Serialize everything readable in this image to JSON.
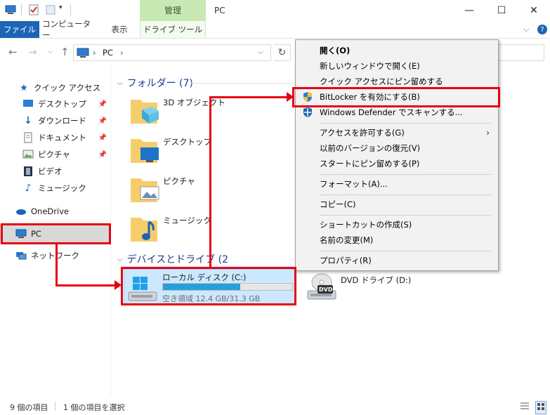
{
  "window": {
    "title": "PC",
    "contextual_tab_header": "管理"
  },
  "ribbon": {
    "tabs": [
      "ファイル",
      "コンピューター",
      "表示",
      "ドライブ ツール"
    ]
  },
  "address": {
    "path": [
      "PC"
    ],
    "separator": "›"
  },
  "nav": {
    "quick_access": "クイック アクセス",
    "items": [
      {
        "label": "デスクトップ",
        "pinned": true
      },
      {
        "label": "ダウンロード",
        "pinned": true
      },
      {
        "label": "ドキュメント",
        "pinned": true
      },
      {
        "label": "ピクチャ",
        "pinned": true
      },
      {
        "label": "ビデオ",
        "pinned": false
      },
      {
        "label": "ミュージック",
        "pinned": false
      }
    ],
    "onedrive": "OneDrive",
    "pc": "PC",
    "network": "ネットワーク"
  },
  "content": {
    "folders_header": "フォルダー (7)",
    "folders": [
      "3D オブジェクト",
      "デスクトップ",
      "ピクチャ",
      "ミュージック"
    ],
    "devices_header": "デバイスとドライブ (2",
    "drive_c": {
      "label": "ローカル ディスク (C:)",
      "space": "空き領域 12.4 GB/31.3 GB",
      "used_fraction": 0.6
    },
    "drive_d": {
      "label": "DVD ドライブ (D:)",
      "icon_text": "DVD"
    }
  },
  "context_menu": {
    "items": [
      "開く(O)",
      "新しいウィンドウで開く(E)",
      "クイック アクセスにピン留めする",
      "BitLocker を有効にする(B)",
      "Windows Defender でスキャンする...",
      "アクセスを許可する(G)",
      "以前のバージョンの復元(V)",
      "スタートにピン留めする(P)",
      "フォーマット(A)...",
      "コピー(C)",
      "ショートカットの作成(S)",
      "名前の変更(M)",
      "プロパティ(R)"
    ]
  },
  "status": {
    "item_count": "9 個の項目",
    "selected": "1 個の項目を選択"
  },
  "colors": {
    "accent": "#1c65b5",
    "annotation_red": "#e60012",
    "selection": "#cce8ff",
    "contextual_green": "#c9e9b4"
  }
}
